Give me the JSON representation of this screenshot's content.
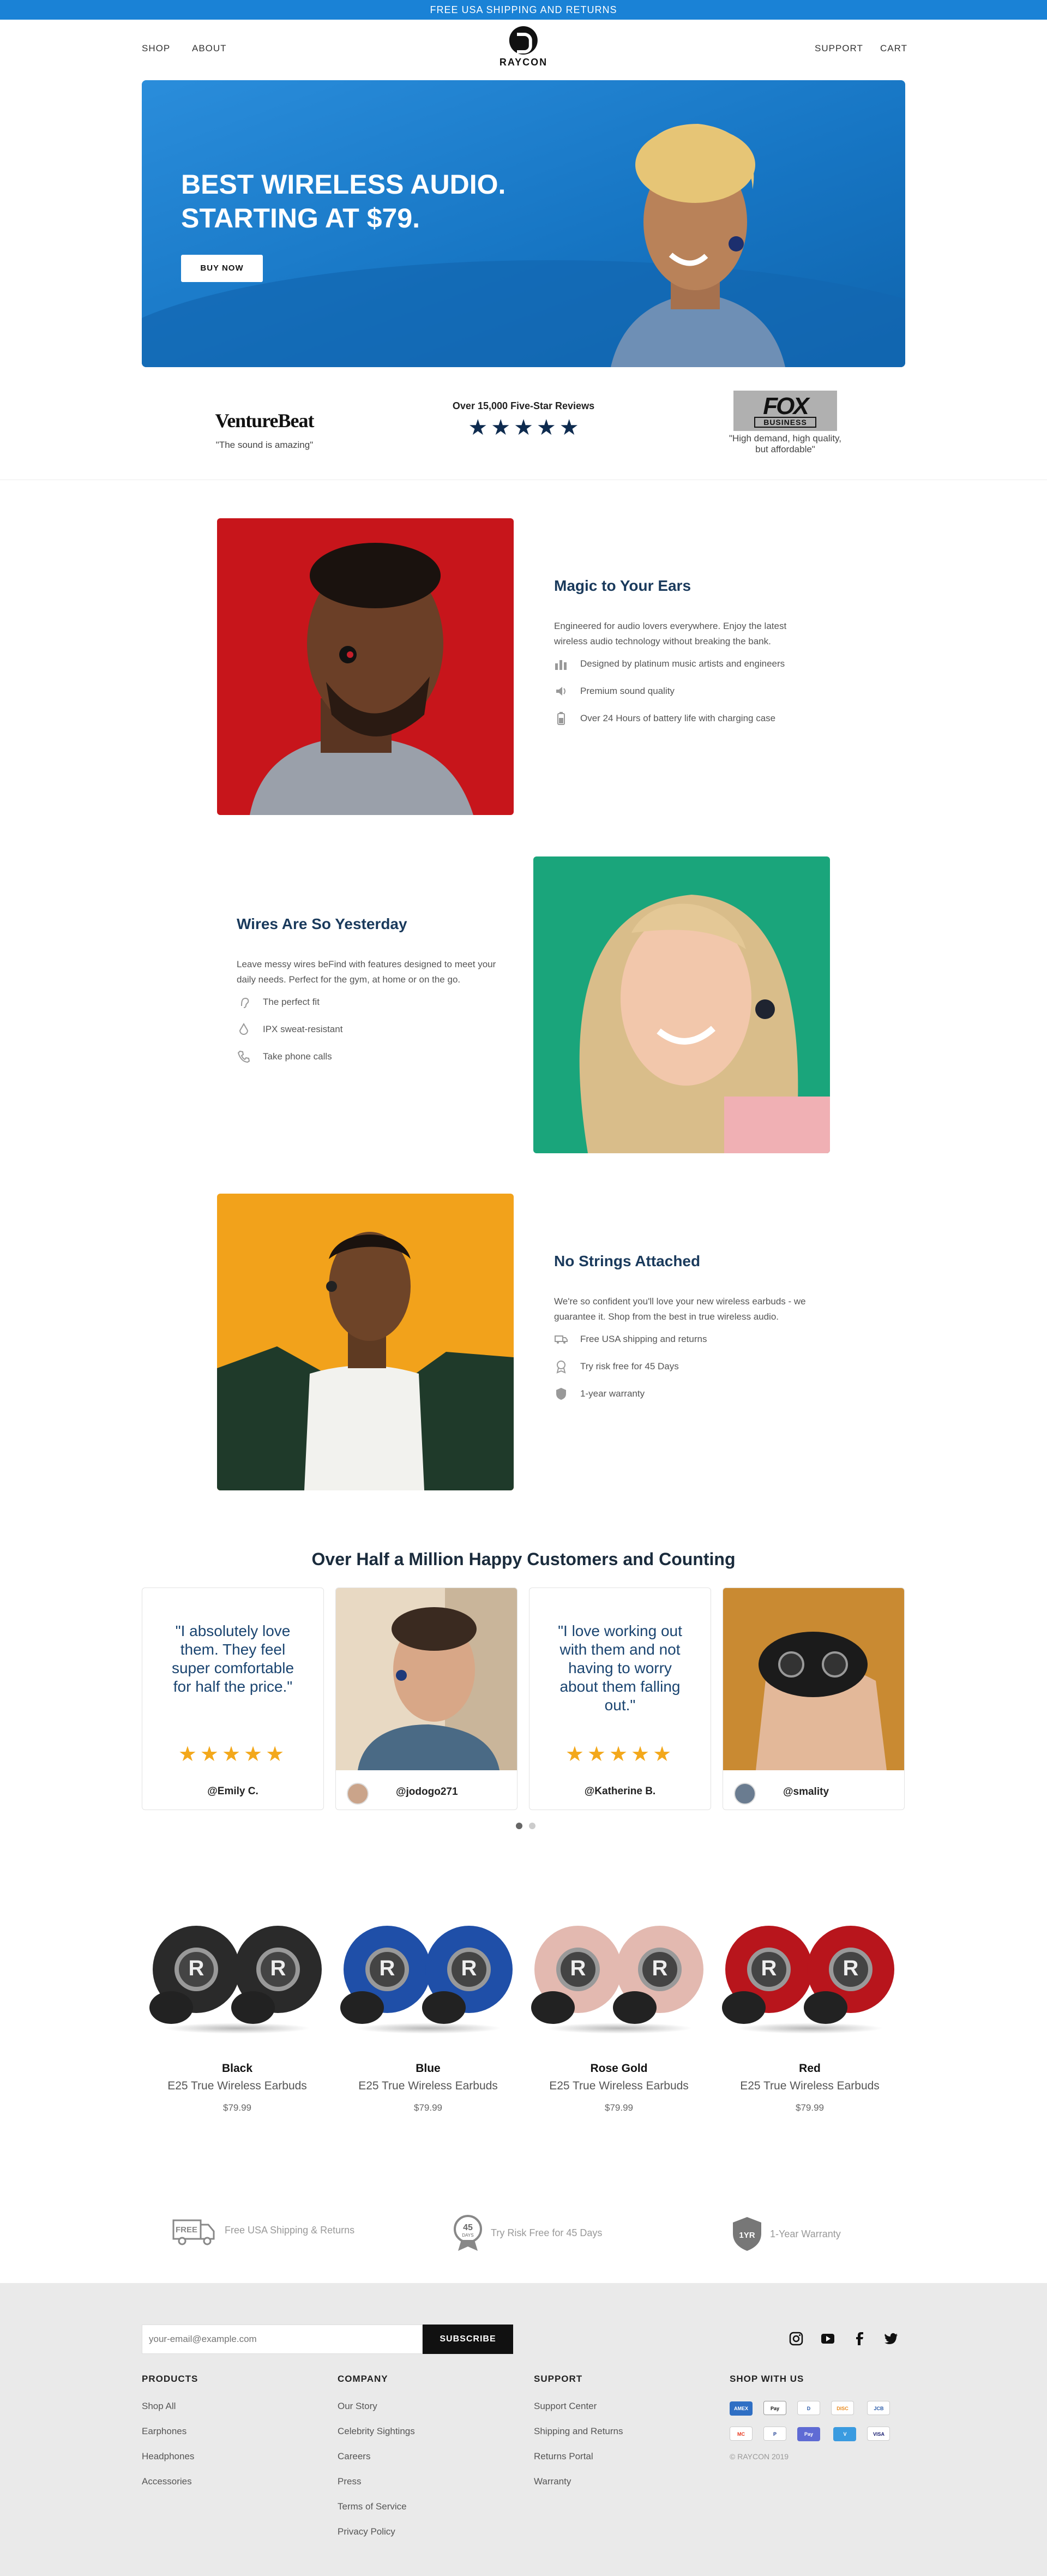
{
  "promo": "FREE USA SHIPPING AND RETURNS",
  "nav": {
    "shop": "SHOP",
    "about": "ABOUT",
    "support": "SUPPORT",
    "cart": "CART",
    "brand": "RAYCON"
  },
  "hero": {
    "line1": "BEST WIRELESS AUDIO.",
    "line2": "STARTING AT $79.",
    "button": "BUY NOW"
  },
  "press": {
    "venturebeat": {
      "logo": "VentureBeat",
      "quote": "\"The sound is amazing\""
    },
    "reviews": {
      "title": "Over 15,000 Five-Star Reviews",
      "stars": 5
    },
    "fox": {
      "logo_top": "FOX",
      "logo_bottom": "BUSINESS",
      "quote": "\"High demand, high quality, but affordable\""
    }
  },
  "features": [
    {
      "title": "Magic to Your Ears",
      "body": "Engineered for audio lovers everywhere. Enjoy the latest wireless audio technology without breaking the bank.",
      "items": [
        {
          "icon": "equalizer-icon",
          "text": "Designed by platinum music artists and engineers"
        },
        {
          "icon": "sound-icon",
          "text": "Premium sound quality"
        },
        {
          "icon": "battery-icon",
          "text": "Over 24 Hours of battery life with charging case"
        }
      ]
    },
    {
      "title": "Wires Are So Yesterday",
      "body": "Leave messy wires beFind with features designed to meet your daily needs. Perfect for the gym, at home or on the go.",
      "items": [
        {
          "icon": "ear-icon",
          "text": "The perfect fit"
        },
        {
          "icon": "water-drop-icon",
          "text": "IPX sweat-resistant"
        },
        {
          "icon": "phone-icon",
          "text": "Take phone calls"
        }
      ]
    },
    {
      "title": "No Strings Attached",
      "body": "We're so confident you'll love your new wireless earbuds - we guarantee it. Shop from the best in true wireless audio.",
      "items": [
        {
          "icon": "truck-icon",
          "text": "Free USA shipping and returns"
        },
        {
          "icon": "badge-icon",
          "text": "Try risk free for 45 Days"
        },
        {
          "icon": "shield-icon",
          "text": "1-year warranty"
        }
      ]
    }
  ],
  "testimonials": {
    "title": "Over Half a Million Happy Customers and Counting",
    "cards": [
      {
        "quote": "\"I absolutely love them. They feel super comfortable for half the price.\"",
        "handle": "@Emily C."
      },
      {
        "handle": "@jodogo271"
      },
      {
        "quote": "\"I love working out with them and not having to worry about them falling out.\"",
        "handle": "@Katherine B."
      },
      {
        "handle": "@smality"
      }
    ],
    "star_glyphs": "★★★★★"
  },
  "products": [
    {
      "color_name": "Black",
      "model": "E25 True Wireless Earbuds",
      "price": "$79.99",
      "hex": "#2a2a2a"
    },
    {
      "color_name": "Blue",
      "model": "E25 True Wireless Earbuds",
      "price": "$79.99",
      "hex": "#1f4fa8"
    },
    {
      "color_name": "Rose Gold",
      "model": "E25 True Wireless Earbuds",
      "price": "$79.99",
      "hex": "#e3b9b0"
    },
    {
      "color_name": "Red",
      "model": "E25 True Wireless Earbuds",
      "price": "$79.99",
      "hex": "#b8151c"
    }
  ],
  "perks": [
    {
      "icon": "free-truck-icon",
      "badge": "FREE",
      "text": "Free USA Shipping & Returns"
    },
    {
      "icon": "ribbon-icon",
      "badge": "45",
      "badge_sub": "DAYS",
      "text": "Try Risk Free for 45 Days"
    },
    {
      "icon": "shield-icon",
      "badge": "1YR",
      "text": "1-Year Warranty"
    }
  ],
  "footer": {
    "email_placeholder": "your-email@example.com",
    "subscribe": "SUBSCRIBE",
    "social": [
      "instagram-icon",
      "youtube-icon",
      "facebook-icon",
      "twitter-icon"
    ],
    "products": {
      "title": "PRODUCTS",
      "links": [
        "Shop All",
        "Earphones",
        "Headphones",
        "Accessories"
      ]
    },
    "company": {
      "title": "COMPANY",
      "links": [
        "Our Story",
        "Celebrity Sightings",
        "Careers",
        "Press",
        "Terms of Service",
        "Privacy Policy"
      ]
    },
    "support": {
      "title": "SUPPORT",
      "links": [
        "Support Center",
        "Shipping and Returns",
        "Returns Portal",
        "Warranty"
      ]
    },
    "shop_with_us": {
      "title": "SHOP WITH US",
      "payments": [
        "AMEX",
        "Pay",
        "D",
        "DISC",
        "JCB",
        "MC",
        "P",
        "Pay",
        "V",
        "VISA"
      ]
    },
    "copyright": "© RAYCON 2019"
  },
  "colors": {
    "promo": "#1a82d6",
    "navy": "#1a3a5c",
    "star": "#f3a81b"
  }
}
